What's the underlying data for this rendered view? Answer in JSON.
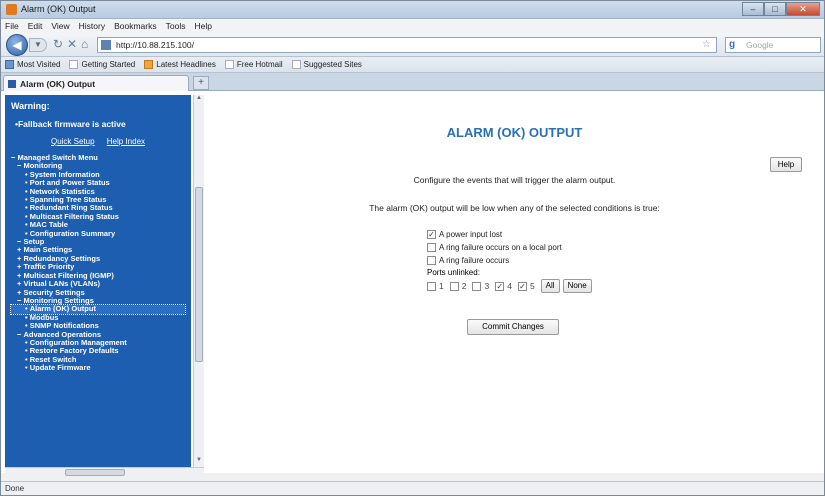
{
  "window": {
    "title": "Alarm (OK) Output"
  },
  "menu": [
    "File",
    "Edit",
    "View",
    "History",
    "Bookmarks",
    "Tools",
    "Help"
  ],
  "nav": {
    "url": "http://10.88.215.100/",
    "search_placeholder": "Google"
  },
  "bookmarks": [
    "Most Visited",
    "Getting Started",
    "Latest Headlines",
    "Free Hotmail",
    "Suggested Sites"
  ],
  "tab": {
    "title": "Alarm (OK) Output"
  },
  "sidebar": {
    "warning": "Warning:",
    "fallback": "Fallback firmware is active",
    "quick_setup": "Quick Setup",
    "help_index": "Help Index",
    "tree": [
      {
        "label": "Managed Switch Menu",
        "level": "l0"
      },
      {
        "label": "Monitoring",
        "level": "l1"
      },
      {
        "label": "System Information",
        "level": "l2"
      },
      {
        "label": "Port and Power Status",
        "level": "l2"
      },
      {
        "label": "Network Statistics",
        "level": "l2"
      },
      {
        "label": "Spanning Tree Status",
        "level": "l2"
      },
      {
        "label": "Redundant Ring Status",
        "level": "l2"
      },
      {
        "label": "Multicast Filtering Status",
        "level": "l2"
      },
      {
        "label": "MAC Table",
        "level": "l2"
      },
      {
        "label": "Configuration Summary",
        "level": "l2"
      },
      {
        "label": "Setup",
        "level": "l1"
      },
      {
        "label": "Main Settings",
        "level": "l1c"
      },
      {
        "label": "Redundancy Settings",
        "level": "l1c"
      },
      {
        "label": "Traffic Priority",
        "level": "l1c"
      },
      {
        "label": "Multicast Filtering (IGMP)",
        "level": "l1c"
      },
      {
        "label": "Virtual LANs (VLANs)",
        "level": "l1c"
      },
      {
        "label": "Security Settings",
        "level": "l1c"
      },
      {
        "label": "Monitoring Settings",
        "level": "l1"
      },
      {
        "label": "Alarm (OK) Output",
        "level": "l2",
        "selected": true
      },
      {
        "label": "Modbus",
        "level": "l2"
      },
      {
        "label": "SNMP Notifications",
        "level": "l2"
      },
      {
        "label": "Advanced Operations",
        "level": "l1"
      },
      {
        "label": "Configuration Management",
        "level": "l2"
      },
      {
        "label": "Restore Factory Defaults",
        "level": "l2"
      },
      {
        "label": "Reset Switch",
        "level": "l2"
      },
      {
        "label": "Update Firmware",
        "level": "l2"
      }
    ]
  },
  "main": {
    "heading": "ALARM (OK) OUTPUT",
    "help_label": "Help",
    "desc1": "Configure the events that will trigger the alarm output.",
    "desc2": "The alarm (OK) output will be low when any of the selected conditions is true:",
    "options": [
      {
        "label": "A power input lost",
        "checked": true
      },
      {
        "label": "A ring failure occurs on a local port",
        "checked": false
      },
      {
        "label": "A ring failure occurs",
        "checked": false
      }
    ],
    "ports_label": "Ports unlinked:",
    "ports": [
      {
        "label": "1",
        "checked": false
      },
      {
        "label": "2",
        "checked": false
      },
      {
        "label": "3",
        "checked": false
      },
      {
        "label": "4",
        "checked": true
      },
      {
        "label": "5",
        "checked": true
      }
    ],
    "all_label": "All",
    "none_label": "None",
    "commit_label": "Commit Changes"
  },
  "status": {
    "text": "Done"
  }
}
